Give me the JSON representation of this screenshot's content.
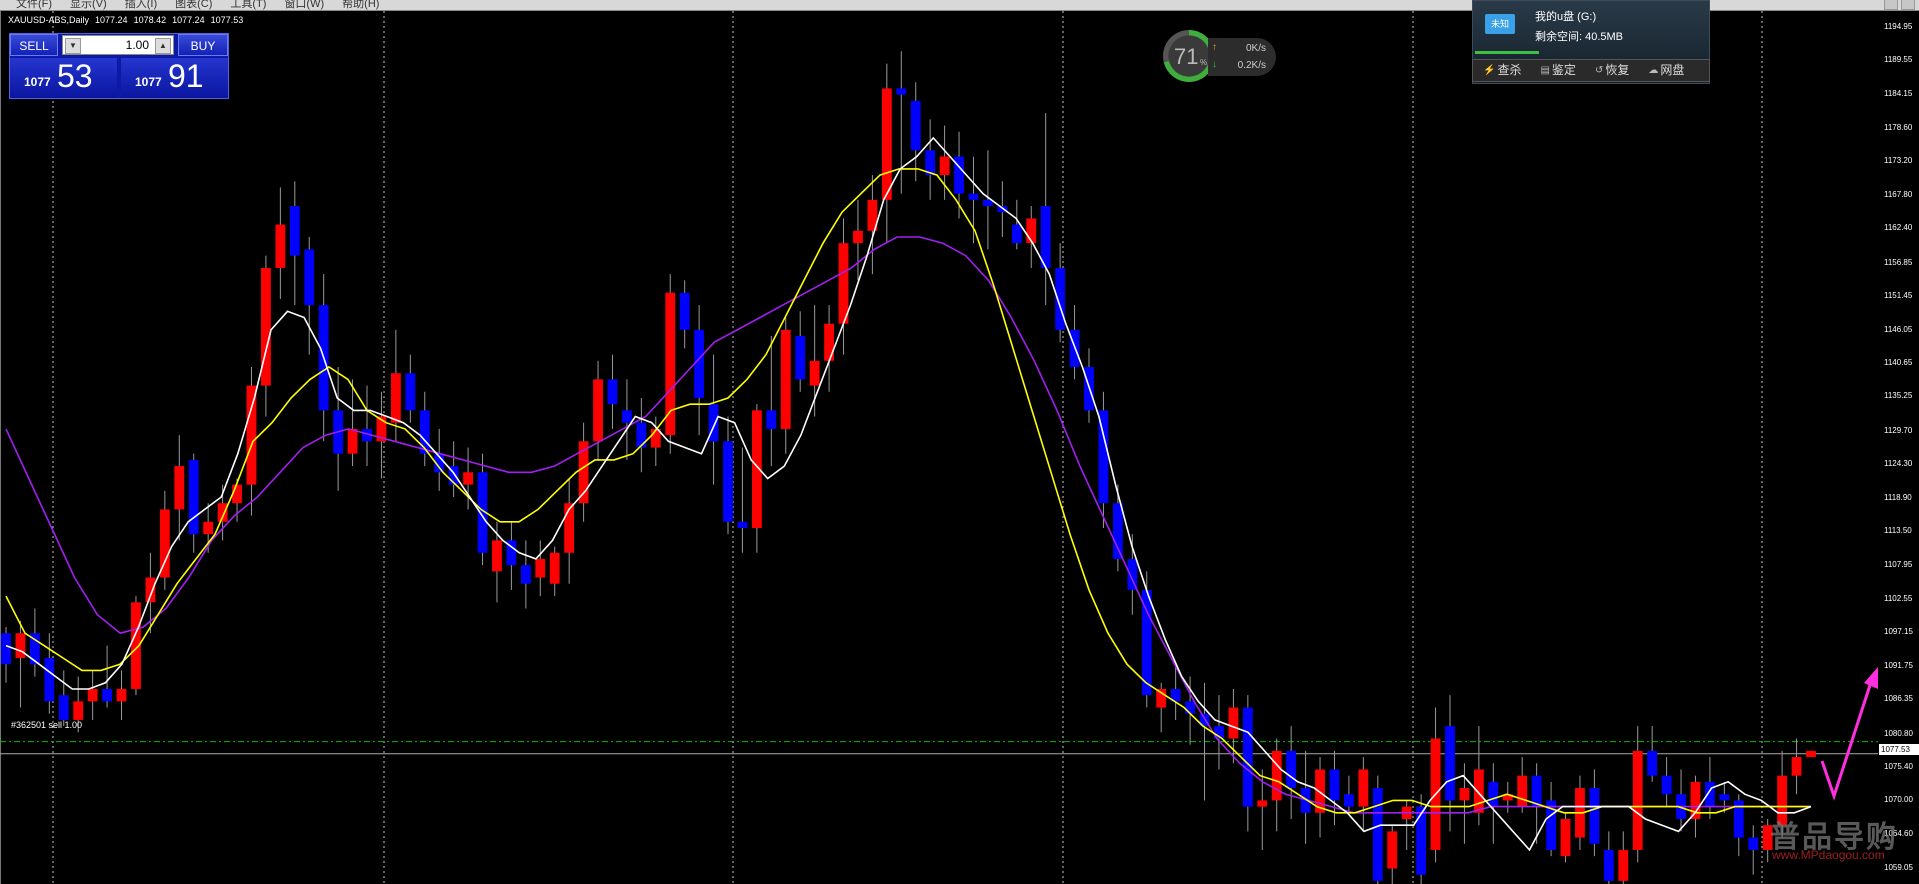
{
  "menu": {
    "items": [
      "文件(F)",
      "显示(V)",
      "插入(I)",
      "图表(C)",
      "工具(T)",
      "窗口(W)",
      "帮助(H)"
    ]
  },
  "symbol": {
    "name": "XAUUSD-ABS,Daily",
    "open": "1077.24",
    "high": "1078.42",
    "low": "1077.24",
    "close": "1077.53"
  },
  "trade_panel": {
    "sell_label": "SELL",
    "buy_label": "BUY",
    "lot": "1.00",
    "sell_small": "1077",
    "sell_big": "53",
    "buy_small": "1077",
    "buy_big": "91"
  },
  "order_label": "#362501 sell 1.00",
  "current_price": "1077.53",
  "net_widget": {
    "cpu": "71",
    "cpu_unit": "%",
    "up_speed": "0K/s",
    "down_speed": "0.2K/s"
  },
  "usb": {
    "icon_label": "未知",
    "name": "我的u盘 (G:)",
    "space_label": "剩余空间: 40.5MB",
    "actions": [
      {
        "label": "查杀",
        "icon": "lightning-icon"
      },
      {
        "label": "鉴定",
        "icon": "clip-icon"
      },
      {
        "label": "恢复",
        "icon": "restore-icon"
      },
      {
        "label": "网盘",
        "icon": "cloud-icon"
      }
    ]
  },
  "watermark": {
    "main": "普品导购",
    "url": "www.MPdaogou.com"
  },
  "colors": {
    "bull": "#ff0000",
    "bear": "#0000ff",
    "ma_fast": "#ffffff",
    "ma_mid": "#ffff00",
    "ma_slow": "#a020f0",
    "annotation_arrow": "#ff2fe0",
    "order_line": "#00c000"
  },
  "chart_data": {
    "type": "candlestick",
    "ylim": [
      1056.5,
      1197.5
    ],
    "y_ticks": [
      "1194.95",
      "1189.55",
      "1184.15",
      "1178.60",
      "1173.20",
      "1167.80",
      "1162.40",
      "1156.85",
      "1151.45",
      "1146.05",
      "1140.65",
      "1135.25",
      "1129.70",
      "1124.30",
      "1118.90",
      "1113.50",
      "1107.95",
      "1102.55",
      "1097.15",
      "1091.75",
      "1086.35",
      "1080.80",
      "1075.40",
      "1070.00",
      "1064.60",
      "1059.05"
    ],
    "candles": [
      [
        1097,
        1098,
        1089,
        1092
      ],
      [
        1093,
        1099,
        1085,
        1097
      ],
      [
        1097,
        1101,
        1090,
        1092
      ],
      [
        1093,
        1097,
        1084,
        1086
      ],
      [
        1087,
        1091,
        1082,
        1083
      ],
      [
        1083,
        1090,
        1081,
        1086
      ],
      [
        1086,
        1091,
        1083,
        1088
      ],
      [
        1088,
        1095,
        1085,
        1086
      ],
      [
        1086,
        1091,
        1083,
        1088
      ],
      [
        1088,
        1103,
        1087,
        1102
      ],
      [
        1102,
        1110,
        1097,
        1106
      ],
      [
        1106,
        1120,
        1104,
        1117
      ],
      [
        1117,
        1129,
        1112,
        1124
      ],
      [
        1125,
        1126,
        1110,
        1113
      ],
      [
        1113,
        1118,
        1110,
        1115
      ],
      [
        1115,
        1121,
        1112,
        1118
      ],
      [
        1118,
        1122,
        1115,
        1121
      ],
      [
        1121,
        1140,
        1116,
        1137
      ],
      [
        1137,
        1158,
        1132,
        1156
      ],
      [
        1156,
        1169,
        1151,
        1163
      ],
      [
        1166,
        1170,
        1150,
        1158
      ],
      [
        1159,
        1161,
        1142,
        1150
      ],
      [
        1150,
        1155,
        1128,
        1133
      ],
      [
        1133,
        1140,
        1120,
        1126
      ],
      [
        1126,
        1138,
        1124,
        1130
      ],
      [
        1130,
        1137,
        1124,
        1128
      ],
      [
        1128,
        1136,
        1122,
        1132
      ],
      [
        1131,
        1146,
        1128,
        1139
      ],
      [
        1139,
        1142,
        1131,
        1133
      ],
      [
        1133,
        1136,
        1124,
        1126
      ],
      [
        1126,
        1130,
        1120,
        1123
      ],
      [
        1124,
        1128,
        1119,
        1121
      ],
      [
        1121,
        1127,
        1117,
        1123
      ],
      [
        1123,
        1126,
        1108,
        1110
      ],
      [
        1107,
        1115,
        1102,
        1112
      ],
      [
        1112,
        1115,
        1104,
        1108
      ],
      [
        1108,
        1112,
        1101,
        1105
      ],
      [
        1106,
        1112,
        1103,
        1109
      ],
      [
        1105,
        1111,
        1103,
        1110
      ],
      [
        1110,
        1122,
        1105,
        1118
      ],
      [
        1118,
        1131,
        1115,
        1128
      ],
      [
        1128,
        1141,
        1125,
        1138
      ],
      [
        1138,
        1142,
        1130,
        1134
      ],
      [
        1133,
        1138,
        1125,
        1131
      ],
      [
        1131,
        1135,
        1123,
        1127
      ],
      [
        1127,
        1132,
        1124,
        1130
      ],
      [
        1129,
        1155,
        1126,
        1152
      ],
      [
        1152,
        1154,
        1143,
        1146
      ],
      [
        1146,
        1150,
        1129,
        1135
      ],
      [
        1134,
        1142,
        1121,
        1128
      ],
      [
        1128,
        1132,
        1113,
        1115
      ],
      [
        1115,
        1127,
        1110,
        1114
      ],
      [
        1114,
        1134,
        1110,
        1133
      ],
      [
        1133,
        1145,
        1124,
        1130
      ],
      [
        1130,
        1148,
        1126,
        1146
      ],
      [
        1145,
        1149,
        1136,
        1138
      ],
      [
        1137,
        1150,
        1132,
        1141
      ],
      [
        1141,
        1150,
        1136,
        1147
      ],
      [
        1147,
        1164,
        1142,
        1160
      ],
      [
        1160,
        1167,
        1154,
        1162
      ],
      [
        1162,
        1171,
        1155,
        1167
      ],
      [
        1167,
        1189,
        1160,
        1185
      ],
      [
        1185,
        1191,
        1168,
        1184
      ],
      [
        1183,
        1186,
        1170,
        1175
      ],
      [
        1175,
        1180,
        1167,
        1171
      ],
      [
        1171,
        1179,
        1167,
        1174
      ],
      [
        1174,
        1178,
        1164,
        1168
      ],
      [
        1168,
        1174,
        1160,
        1167
      ],
      [
        1167,
        1175,
        1159,
        1166
      ],
      [
        1166,
        1170,
        1161,
        1165
      ],
      [
        1163,
        1167,
        1159,
        1160
      ],
      [
        1160,
        1166,
        1156,
        1164
      ],
      [
        1166,
        1181,
        1150,
        1156
      ],
      [
        1156,
        1160,
        1144,
        1146
      ],
      [
        1146,
        1150,
        1138,
        1140
      ],
      [
        1140,
        1143,
        1131,
        1133
      ],
      [
        1133,
        1136,
        1114,
        1118
      ],
      [
        1118,
        1121,
        1107,
        1109
      ],
      [
        1109,
        1113,
        1100,
        1104
      ],
      [
        1104,
        1107,
        1085,
        1087
      ],
      [
        1085,
        1089,
        1081,
        1088
      ],
      [
        1088,
        1092,
        1083,
        1086
      ],
      [
        1086,
        1090,
        1079,
        1084
      ],
      [
        1084,
        1089,
        1070,
        1082
      ],
      [
        1082,
        1087,
        1075,
        1080
      ],
      [
        1080,
        1088,
        1076,
        1085
      ],
      [
        1085,
        1087,
        1065,
        1069
      ],
      [
        1069,
        1075,
        1062,
        1070
      ],
      [
        1070,
        1080,
        1065,
        1078
      ],
      [
        1078,
        1082,
        1067,
        1072
      ],
      [
        1072,
        1078,
        1063,
        1068
      ],
      [
        1068,
        1077,
        1064,
        1075
      ],
      [
        1075,
        1078,
        1066,
        1070
      ],
      [
        1071,
        1074,
        1068,
        1069
      ],
      [
        1069,
        1077,
        1065,
        1075
      ],
      [
        1072,
        1074,
        1055,
        1057
      ],
      [
        1059,
        1066,
        1055,
        1065
      ],
      [
        1067,
        1070,
        1062,
        1069
      ],
      [
        1069,
        1071,
        1055,
        1058
      ],
      [
        1062,
        1085,
        1060,
        1080
      ],
      [
        1082,
        1087,
        1065,
        1070
      ],
      [
        1070,
        1076,
        1063,
        1072
      ],
      [
        1068,
        1082,
        1066,
        1075
      ],
      [
        1073,
        1076,
        1063,
        1069
      ],
      [
        1070,
        1073,
        1068,
        1071
      ],
      [
        1069,
        1077,
        1068,
        1074
      ],
      [
        1074,
        1076,
        1063,
        1069
      ],
      [
        1070,
        1073,
        1061,
        1062
      ],
      [
        1061,
        1068,
        1060,
        1067
      ],
      [
        1064,
        1074,
        1062,
        1072
      ],
      [
        1072,
        1075,
        1061,
        1063
      ],
      [
        1062,
        1065,
        1055,
        1057
      ],
      [
        1057,
        1065,
        1056,
        1062
      ],
      [
        1062,
        1082,
        1060,
        1078
      ],
      [
        1078,
        1082,
        1073,
        1074
      ],
      [
        1074,
        1077,
        1069,
        1071
      ],
      [
        1071,
        1075,
        1065,
        1067
      ],
      [
        1067,
        1074,
        1064,
        1073
      ],
      [
        1073,
        1077,
        1067,
        1069
      ],
      [
        1071,
        1073,
        1068,
        1070
      ],
      [
        1070,
        1071,
        1061,
        1064
      ],
      [
        1064,
        1066,
        1058,
        1062
      ],
      [
        1062,
        1067,
        1060,
        1066
      ],
      [
        1066,
        1078,
        1064,
        1074
      ],
      [
        1074,
        1080,
        1071,
        1077
      ],
      [
        1077,
        1078,
        1077,
        1078
      ]
    ],
    "ma_fast": [
      1095,
      1094,
      1092,
      1090,
      1088,
      1088,
      1089,
      1092,
      1098,
      1105,
      1111,
      1115,
      1117,
      1119,
      1126,
      1135,
      1146,
      1149,
      1148,
      1143,
      1135,
      1133,
      1133,
      1132,
      1131,
      1129,
      1126,
      1123,
      1119,
      1115,
      1112,
      1110,
      1109,
      1112,
      1117,
      1120,
      1124,
      1128,
      1132,
      1131,
      1128,
      1127,
      1126,
      1132,
      1131,
      1125,
      1122,
      1124,
      1129,
      1136,
      1143,
      1150,
      1158,
      1167,
      1172,
      1174,
      1177,
      1174,
      1171,
      1168,
      1166,
      1164,
      1160,
      1155,
      1147,
      1140,
      1132,
      1121,
      1111,
      1103,
      1096,
      1090,
      1086,
      1083,
      1082,
      1081,
      1078,
      1075,
      1073,
      1072,
      1070,
      1068,
      1065,
      1066,
      1066,
      1066,
      1070,
      1073,
      1074,
      1071,
      1068,
      1065,
      1062,
      1067,
      1069,
      1069,
      1069,
      1069,
      1069,
      1067,
      1066,
      1065,
      1068,
      1072,
      1073,
      1071,
      1070,
      1068,
      1068,
      1069
    ],
    "ma_mid": [
      1103,
      1097,
      1095,
      1093,
      1091,
      1091,
      1092,
      1095,
      1100,
      1105,
      1109,
      1113,
      1120,
      1128,
      1131,
      1135,
      1138,
      1140,
      1138,
      1133,
      1131,
      1130,
      1127,
      1123,
      1120,
      1117,
      1115,
      1115,
      1117,
      1120,
      1123,
      1125,
      1125,
      1126,
      1129,
      1133,
      1134,
      1134,
      1135,
      1138,
      1142,
      1148,
      1154,
      1160,
      1165,
      1168,
      1171,
      1172,
      1172,
      1171,
      1167,
      1162,
      1153,
      1143,
      1133,
      1123,
      1113,
      1104,
      1097,
      1092,
      1089,
      1087,
      1085,
      1082,
      1080,
      1077,
      1074,
      1073,
      1071,
      1069,
      1068,
      1068,
      1069,
      1070,
      1070,
      1069,
      1069,
      1069,
      1070,
      1071,
      1070,
      1069,
      1068,
      1068,
      1069,
      1069,
      1069,
      1069,
      1069,
      1068,
      1068,
      1069,
      1069,
      1069,
      1069,
      1069
    ],
    "ma_slow": [
      1130,
      1122,
      1114,
      1106,
      1100,
      1097,
      1098,
      1101,
      1106,
      1112,
      1116,
      1119,
      1123,
      1127,
      1129,
      1130,
      1129,
      1128,
      1127,
      1126,
      1125,
      1124,
      1123,
      1123,
      1124,
      1126,
      1128,
      1130,
      1132,
      1136,
      1140,
      1144,
      1146,
      1148,
      1150,
      1152,
      1154,
      1156,
      1159,
      1161,
      1161,
      1160,
      1158,
      1154,
      1148,
      1141,
      1133,
      1124,
      1116,
      1108,
      1100,
      1093,
      1086,
      1080,
      1076,
      1073,
      1071,
      1070,
      1069,
      1068,
      1068,
      1068,
      1068,
      1068,
      1068,
      1069,
      1069,
      1069,
      1069,
      1069,
      1069,
      1069,
      1069,
      1069,
      1069,
      1069,
      1069,
      1069,
      1069,
      1069
    ],
    "order_price": 1079.5,
    "current_price": 1077.53
  }
}
